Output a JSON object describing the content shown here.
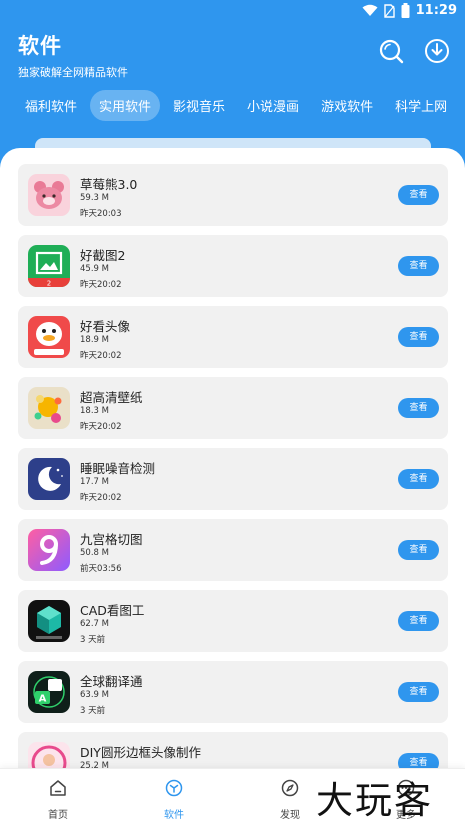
{
  "statusbar": {
    "time": "11:29",
    "icons": [
      "wifi-icon",
      "sim-icon",
      "battery-icon"
    ]
  },
  "header": {
    "title": "软件",
    "subtitle": "独家破解全网精品软件"
  },
  "tabs": [
    {
      "label": "福利软件",
      "active": false
    },
    {
      "label": "实用软件",
      "active": true
    },
    {
      "label": "影视音乐",
      "active": false
    },
    {
      "label": "小说漫画",
      "active": false
    },
    {
      "label": "游戏软件",
      "active": false
    },
    {
      "label": "科学上网",
      "active": false
    }
  ],
  "list": {
    "button_label": "查看",
    "items": [
      {
        "name": "草莓熊3.0",
        "size": "59.3 M",
        "date": "昨天20:03",
        "icon": "strawberry-bear-icon"
      },
      {
        "name": "好截图2",
        "size": "45.9 M",
        "date": "昨天20:02",
        "icon": "screenshot-icon"
      },
      {
        "name": "好看头像",
        "size": "18.9 M",
        "date": "昨天20:02",
        "icon": "duck-avatar-icon"
      },
      {
        "name": "超高清壁纸",
        "size": "18.3 M",
        "date": "昨天20:02",
        "icon": "wallpaper-icon"
      },
      {
        "name": "睡眠噪音检测",
        "size": "17.7 M",
        "date": "昨天20:02",
        "icon": "moon-icon"
      },
      {
        "name": "九宫格切图",
        "size": "50.8 M",
        "date": "前天03:56",
        "icon": "nine-grid-icon"
      },
      {
        "name": "CAD看图工",
        "size": "62.7 M",
        "date": "3 天前",
        "icon": "cad-cube-icon"
      },
      {
        "name": "全球翻译通",
        "size": "63.9 M",
        "date": "3 天前",
        "icon": "translate-icon"
      },
      {
        "name": "DIY圆形边框头像制作",
        "size": "25.2 M",
        "date": "",
        "icon": "round-avatar-icon"
      }
    ]
  },
  "bottomnav": [
    {
      "label": "首页",
      "icon": "home-icon",
      "active": false
    },
    {
      "label": "软件",
      "icon": "software-icon",
      "active": true
    },
    {
      "label": "发现",
      "icon": "compass-icon",
      "active": false
    },
    {
      "label": "更多",
      "icon": "more-icon",
      "active": false
    }
  ],
  "watermark": "大玩客",
  "colors": {
    "primary": "#2f96ee",
    "card": "#f1f1f1"
  }
}
